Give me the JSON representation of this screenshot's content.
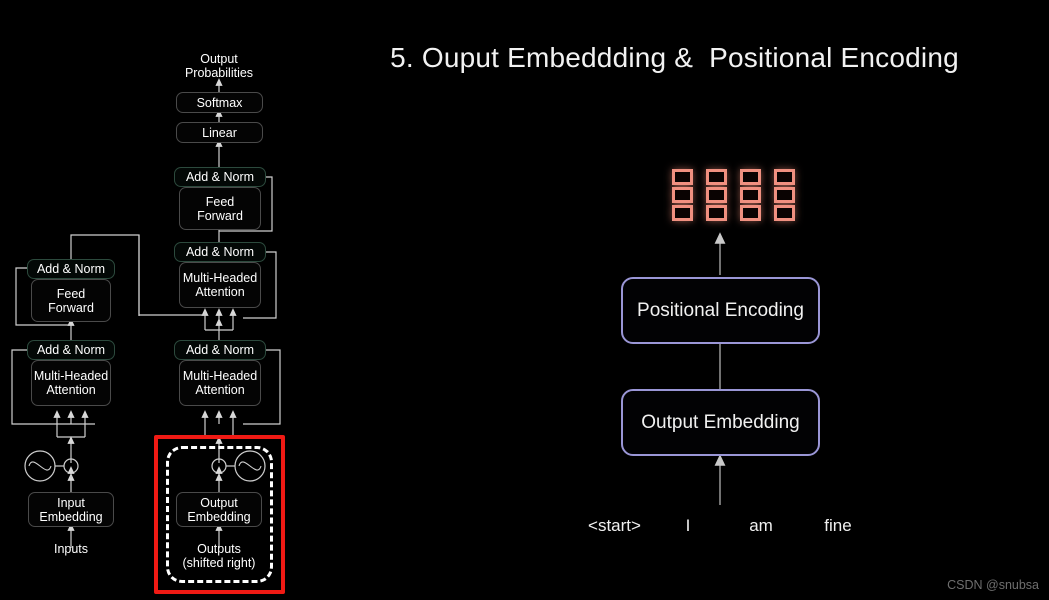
{
  "slide": {
    "title": "5. Ouput Embeddding &  Positional Encoding",
    "watermark": "CSDN @snubsa",
    "background_color": "#000000",
    "box_border_color": "#9a96d6",
    "vector_color": "#f09080",
    "highlight_color": "#f01a14",
    "boxes": [
      {
        "label": "Positional Encoding"
      },
      {
        "label": "Output Embedding"
      }
    ],
    "tokens": [
      {
        "label": "<start>"
      },
      {
        "label": "I"
      },
      {
        "label": "am"
      },
      {
        "label": "fine"
      }
    ],
    "vectors": {
      "count": 4,
      "cells_per_vector": 3,
      "description": "embedding-vectors"
    }
  },
  "architecture": {
    "top_label": "Output\nProbabilities",
    "encoder": {
      "blocks": [
        {
          "label": "Add & Norm"
        },
        {
          "label": "Feed\nForward"
        },
        {
          "label": "Add & Norm"
        },
        {
          "label": "Multi-Headed\nAttention"
        },
        {
          "label": "Input\nEmbedding"
        }
      ],
      "input_label": "Inputs"
    },
    "decoder": {
      "blocks": [
        {
          "label": "Softmax"
        },
        {
          "label": "Linear"
        },
        {
          "label": "Add & Norm"
        },
        {
          "label": "Feed\nForward"
        },
        {
          "label": "Add & Norm"
        },
        {
          "label": "Multi-Headed\nAttention"
        },
        {
          "label": "Add & Norm"
        },
        {
          "label": "Multi-Headed\nAttention"
        },
        {
          "label": "Output\nEmbedding"
        }
      ],
      "input_label": "Outputs\n(shifted right)"
    }
  }
}
